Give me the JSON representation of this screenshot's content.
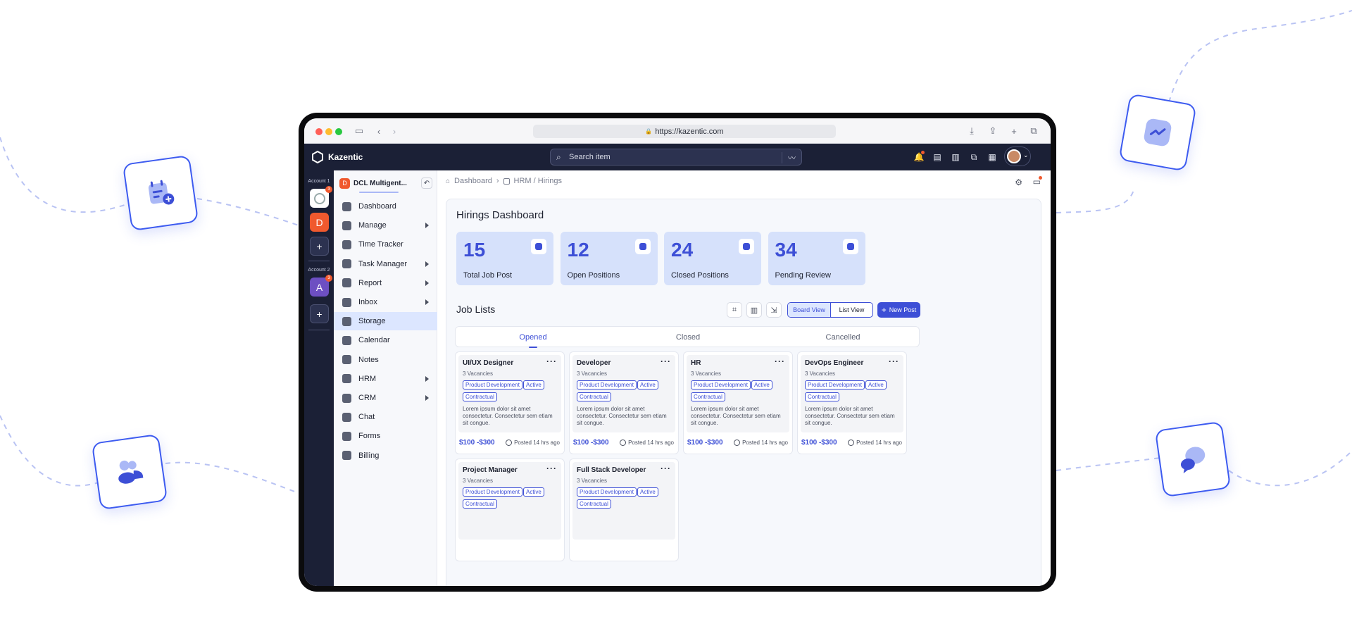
{
  "browser": {
    "url": "https://kazentic.com"
  },
  "app": {
    "name": "Kazentic",
    "search_placeholder": "Search item"
  },
  "accounts": {
    "account1_label": "Account 1",
    "account1_initial": "D",
    "account2_label": "Account 2",
    "account2_initial": "A",
    "account1_badge": "3",
    "account2_badge": "3",
    "add_symbol": "+"
  },
  "workspace": {
    "initial": "D",
    "name": "DCL Multigent..."
  },
  "sidebar": {
    "items": [
      {
        "label": "Dashboard",
        "has_arrow": false
      },
      {
        "label": "Manage",
        "has_arrow": true
      },
      {
        "label": "Time Tracker",
        "has_arrow": false
      },
      {
        "label": "Task Manager",
        "has_arrow": true
      },
      {
        "label": "Report",
        "has_arrow": true
      },
      {
        "label": "Inbox",
        "has_arrow": true
      },
      {
        "label": "Storage",
        "has_arrow": false,
        "active": true
      },
      {
        "label": "Calendar",
        "has_arrow": false
      },
      {
        "label": "Notes",
        "has_arrow": false
      },
      {
        "label": "HRM",
        "has_arrow": true
      },
      {
        "label": "CRM",
        "has_arrow": true
      },
      {
        "label": "Chat",
        "has_arrow": false
      },
      {
        "label": "Forms",
        "has_arrow": false
      },
      {
        "label": "Billing",
        "has_arrow": false
      }
    ]
  },
  "breadcrumb": {
    "root": "Dashboard",
    "current": "HRM / Hirings"
  },
  "dashboard": {
    "title": "Hirings Dashboard",
    "stats": [
      {
        "value": "15",
        "label": "Total Job Post"
      },
      {
        "value": "12",
        "label": "Open Positions"
      },
      {
        "value": "24",
        "label": "Closed Positions"
      },
      {
        "value": "34",
        "label": "Pending Review"
      }
    ]
  },
  "joblists": {
    "title": "Job Lists",
    "board_view": "Board View",
    "list_view": "List View",
    "new_post": "New Post",
    "tabs": [
      "Opened",
      "Closed",
      "Cancelled"
    ],
    "jobs": [
      {
        "title": "UI/UX Designer",
        "vacancies": "3 Vacancies",
        "tags": [
          "Product Development",
          "Active",
          "Contractual"
        ],
        "desc": "Lorem ipsum dolor sit amet consectetur. Consectetur sem etiam sit congue.",
        "price": "$100 -$300",
        "posted": "Posted 14 hrs ago"
      },
      {
        "title": "Developer",
        "vacancies": "3 Vacancies",
        "tags": [
          "Product Development",
          "Active",
          "Contractual"
        ],
        "desc": "Lorem ipsum dolor sit amet consectetur. Consectetur sem etiam sit congue.",
        "price": "$100 -$300",
        "posted": "Posted 14 hrs ago"
      },
      {
        "title": "HR",
        "vacancies": "3 Vacancies",
        "tags": [
          "Product Development",
          "Active",
          "Contractual"
        ],
        "desc": "Lorem ipsum dolor sit amet consectetur. Consectetur sem etiam sit congue.",
        "price": "$100 -$300",
        "posted": "Posted 14 hrs ago"
      },
      {
        "title": "DevOps Engineer",
        "vacancies": "3 Vacancies",
        "tags": [
          "Product Development",
          "Active",
          "Contractual"
        ],
        "desc": "Lorem ipsum dolor sit amet consectetur. Consectetur sem etiam sit congue.",
        "price": "$100 -$300",
        "posted": "Posted 14 hrs ago"
      },
      {
        "title": "Project Manager",
        "vacancies": "3 Vacancies",
        "tags": [
          "Product Development",
          "Active",
          "Contractual"
        ]
      },
      {
        "title": "Full Stack Developer",
        "vacancies": "3 Vacancies",
        "tags": [
          "Product Development",
          "Active",
          "Contractual"
        ]
      }
    ]
  },
  "colors": {
    "accent": "#3d4fd6",
    "appbar": "#1b2036",
    "stat_bg": "#d6e1fb",
    "account_d": "#f0592e",
    "account_a": "#6d4fc2"
  }
}
